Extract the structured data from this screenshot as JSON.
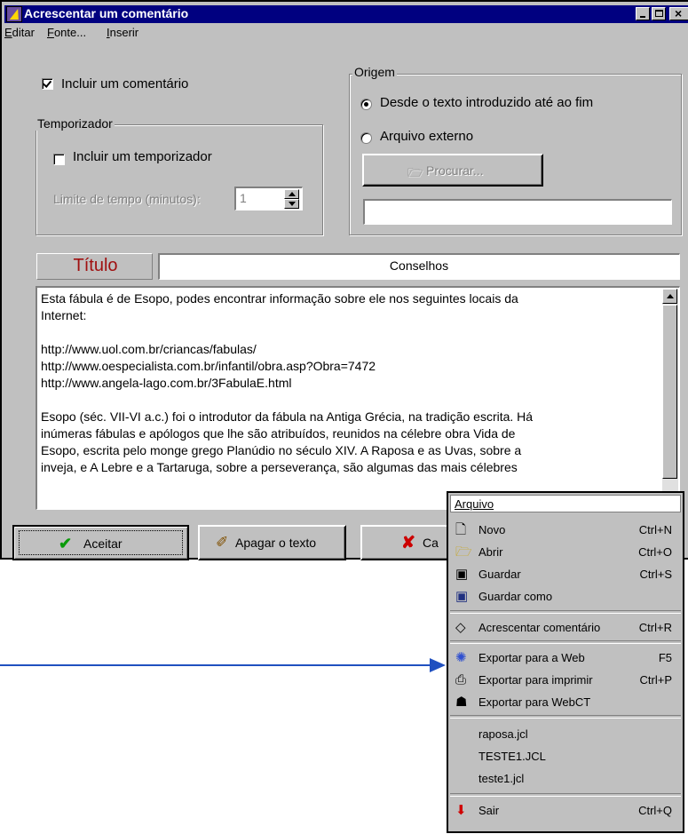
{
  "window": {
    "title": "Acrescentar um comentário",
    "menu": [
      "Editar",
      "Fonte...",
      "Inserir"
    ]
  },
  "include_comment": {
    "label": "Incluir um comentário",
    "checked": true
  },
  "temporizador": {
    "group_label": "Temporizador",
    "include_label": "Incluir um temporizador",
    "limit_label": "Limite de tempo (minutos):",
    "limit_value": "1"
  },
  "origem": {
    "group_label": "Origem",
    "option1": "Desde o texto introduzido até ao fim",
    "option2": "Arquivo externo",
    "browse_label": "Procurar..."
  },
  "titulo": {
    "label": "Título",
    "value": "Conselhos"
  },
  "comment_lines": [
    "Esta fábula é de Esopo, podes encontrar informação sobre ele nos seguintes locais da",
    "Internet:",
    "",
    "http://www.uol.com.br/criancas/fabulas/",
    "http://www.oespecialista.com.br/infantil/obra.asp?Obra=7472",
    "http://www.angela-lago.com.br/3FabulaE.html",
    "",
    "Esopo (séc. VII-VI a.c.) foi o introdutor da fábula na Antiga Grécia, na tradição escrita. Há",
    "inúmeras fábulas e apólogos que lhe são atribuídos, reunidos na célebre obra Vida de",
    "Esopo, escrita pelo monge grego Planúdio no século XIV. A Raposa e as Uvas, sobre a",
    "inveja, e A Lebre e a Tartaruga, sobre a perseverança, são algumas das mais célebres"
  ],
  "buttons": {
    "accept": "Aceitar",
    "clear": "Apagar o texto",
    "cancel": "Ca"
  },
  "arquivo_menu": {
    "title": "Arquivo",
    "items": [
      {
        "label": "Novo",
        "shortcut": "Ctrl+N",
        "icon": "new-file-icon"
      },
      {
        "label": "Abrir",
        "shortcut": "Ctrl+O",
        "icon": "folder-open-icon"
      },
      {
        "label": "Guardar",
        "shortcut": "Ctrl+S",
        "icon": "floppy-icon"
      },
      {
        "label": "Guardar como",
        "shortcut": "",
        "icon": "save-as-icon"
      },
      {
        "label": "Acrescentar comentário",
        "shortcut": "Ctrl+R",
        "icon": "comment-icon"
      },
      {
        "label": "Exportar para a Web",
        "shortcut": "F5",
        "icon": "web-icon"
      },
      {
        "label": "Exportar para imprimir",
        "shortcut": "Ctrl+P",
        "icon": "printer-icon"
      },
      {
        "label": "Exportar para WebCT",
        "shortcut": "",
        "icon": "webct-icon"
      },
      {
        "label": "raposa.jcl",
        "shortcut": ""
      },
      {
        "label": "TESTE1.JCL",
        "shortcut": ""
      },
      {
        "label": "teste1.jcl",
        "shortcut": ""
      },
      {
        "label": "Sair",
        "shortcut": "Ctrl+Q",
        "icon": "exit-arrow-icon"
      }
    ]
  }
}
